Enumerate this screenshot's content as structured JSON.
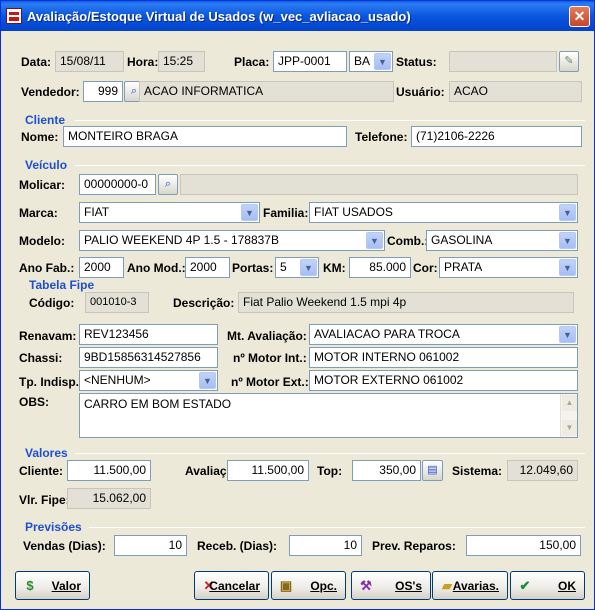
{
  "window": {
    "title": "Avaliação/Estoque Virtual de Usados (w_vec_avliacao_usado)",
    "close_symbol": "✕"
  },
  "header": {
    "data_label": "Data:",
    "data": "15/08/11",
    "hora_label": "Hora:",
    "hora": "15:25",
    "placa_label": "Placa:",
    "placa": "JPP-0001",
    "uf": "BA",
    "status_label": "Status:",
    "status": "",
    "vendedor_label": "Vendedor:",
    "vendedor_codigo": "999",
    "vendedor_nome": "ACAO INFORMATICA",
    "usuario_label": "Usuário:",
    "usuario": "ACAO"
  },
  "cliente": {
    "section": "Cliente",
    "nome_label": "Nome:",
    "nome": "MONTEIRO BRAGA",
    "telefone_label": "Telefone:",
    "telefone": "(71)2106-2226"
  },
  "veiculo": {
    "section": "Veículo",
    "molicar_label": "Molicar:",
    "molicar": "00000000-0",
    "molicar_desc": "",
    "marca_label": "Marca:",
    "marca": "FIAT",
    "familia_label": "Familia:",
    "familia": "FIAT USADOS",
    "modelo_label": "Modelo:",
    "modelo": "PALIO WEEKEND 4P 1.5 - 178837B",
    "comb_label": "Comb.:",
    "comb": "GASOLINA",
    "ano_fab_label": "Ano Fab.:",
    "ano_fab": "2000",
    "ano_mod_label": "Ano Mod.:",
    "ano_mod": "2000",
    "portas_label": "Portas:",
    "portas": "5",
    "km_label": "KM:",
    "km": "85.000",
    "cor_label": "Cor:",
    "cor": "PRATA"
  },
  "fipe": {
    "section": "Tabela Fipe",
    "codigo_label": "Código:",
    "codigo": "001010-3",
    "descricao_label": "Descrição:",
    "descricao": "Fiat Palio Weekend 1.5 mpi 4p"
  },
  "detalhes": {
    "renavam_label": "Renavam:",
    "renavam": "REV123456",
    "mt_label": "Mt. Avaliação:",
    "mt": "AVALIACAO PARA TROCA",
    "chassi_label": "Chassi:",
    "chassi": "9BD15856314527856",
    "motor_int_label": "nº Motor Int.:",
    "motor_int": "MOTOR INTERNO 061002",
    "tp_label": "Tp. Indisp.:",
    "tp": "<NENHUM>",
    "motor_ext_label": "nº Motor Ext.:",
    "motor_ext": "MOTOR EXTERNO 061002",
    "obs_label": "OBS:",
    "obs": "CARRO EM BOM ESTADO"
  },
  "valores": {
    "section": "Valores",
    "cliente_label": "Cliente:",
    "cliente": "11.500,00",
    "avaliacao_label": "Avaliação:",
    "avaliacao": "11.500,00",
    "top_label": "Top:",
    "top": "350,00",
    "sistema_label": "Sistema:",
    "sistema": "12.049,60",
    "fipe_label": "Vlr. Fipe:",
    "fipe": "15.062,00"
  },
  "previsoes": {
    "section": "Previsões",
    "vendas_label": "Vendas (Dias):",
    "vendas": "10",
    "receb_label": "Receb. (Dias):",
    "receb": "10",
    "reparos_label": "Prev. Reparos:",
    "reparos": "150,00"
  },
  "buttons": {
    "valor": "Valor",
    "cancelar": "Cancelar",
    "opc": "Opc.",
    "os": "OS's",
    "avarias": "Avarias.",
    "ok": "OK"
  },
  "icons": {
    "dropdown": "▼",
    "scroll_up": "▲",
    "scroll_down": "▼"
  }
}
